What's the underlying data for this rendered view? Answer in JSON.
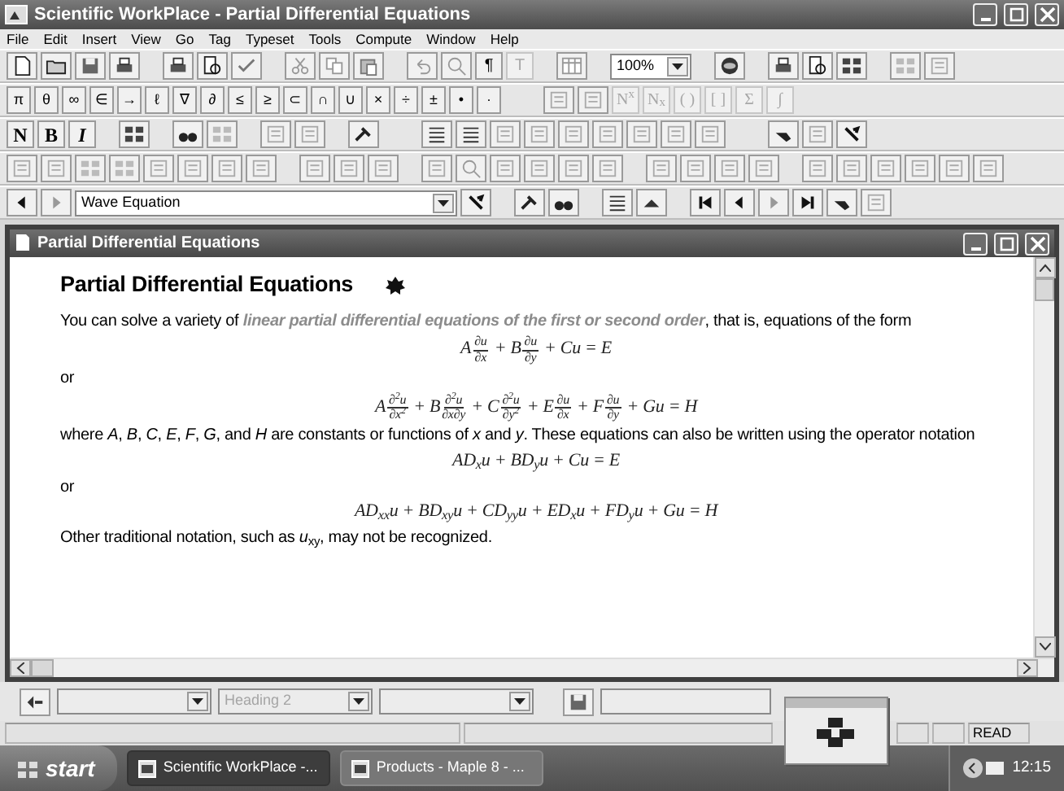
{
  "window": {
    "title": "Scientific WorkPlace - Partial Differential Equations"
  },
  "menu": [
    "File",
    "Edit",
    "Insert",
    "View",
    "Go",
    "Tag",
    "Typeset",
    "Tools",
    "Compute",
    "Window",
    "Help"
  ],
  "standard_toolbar": {
    "text_buttons": [
      {
        "label": "¶",
        "disabled": false
      },
      {
        "label": "T",
        "disabled": true
      }
    ],
    "zoom_box": {
      "value": "100%"
    }
  },
  "symbol_toolbar": {
    "symbols": [
      {
        "label": "π",
        "disabled": false
      },
      {
        "label": "θ",
        "disabled": false
      },
      {
        "label": "∞",
        "disabled": false
      },
      {
        "label": "∈",
        "disabled": false
      },
      {
        "label": "→",
        "disabled": false
      },
      {
        "label": "ℓ",
        "disabled": false
      },
      {
        "label": "∇",
        "disabled": false
      },
      {
        "label": "∂",
        "disabled": false
      },
      {
        "label": "≤",
        "disabled": false
      },
      {
        "label": "≥",
        "disabled": false
      },
      {
        "label": "⊂",
        "disabled": false
      },
      {
        "label": "∩",
        "disabled": false
      },
      {
        "label": "∪",
        "disabled": false
      },
      {
        "label": "×",
        "disabled": false
      },
      {
        "label": "÷",
        "disabled": false
      },
      {
        "label": "±",
        "disabled": false
      },
      {
        "label": "•",
        "disabled": false
      },
      {
        "label": "·",
        "disabled": false
      }
    ],
    "templates": [
      {
        "label": "N$^{x}$",
        "disabled": true
      },
      {
        "label": "N$_{x}$",
        "disabled": true
      },
      {
        "label": "( )",
        "disabled": true
      },
      {
        "label": "[ ]",
        "disabled": true
      },
      {
        "label": "Σ",
        "disabled": true
      },
      {
        "label": "∫",
        "disabled": true
      }
    ]
  },
  "tag_toolbar": {
    "tags": [
      {
        "label": "N",
        "disabled": false
      },
      {
        "label": "B",
        "disabled": false
      },
      {
        "label": "I",
        "disabled": false
      }
    ]
  },
  "navigation_toolbar": {
    "fragment_box": {
      "value": "Wave Equation"
    }
  },
  "document": {
    "title": "Partial Differential Equations",
    "heading": "Partial Differential Equations",
    "blocks": [
      {
        "kind": "para",
        "text": "You can solve a variety of **linear partial differential equations of the first or second order**, that is, equations of the form"
      },
      {
        "kind": "math",
        "parts": [
          {
            "kind": "text",
            "text": "A"
          },
          {
            "kind": "frac",
            "num": "∂u",
            "den": "∂x"
          },
          {
            "kind": "text",
            "text": " + B"
          },
          {
            "kind": "frac",
            "num": "∂u",
            "den": "∂y"
          },
          {
            "kind": "text",
            "text": " + Cu = E"
          }
        ]
      },
      {
        "kind": "para",
        "text": "or"
      },
      {
        "kind": "math",
        "parts": [
          {
            "kind": "text",
            "text": "A"
          },
          {
            "kind": "frac",
            "num": "∂$^{2}$u",
            "den": "∂x$^{2}$"
          },
          {
            "kind": "text",
            "text": " + B"
          },
          {
            "kind": "frac",
            "num": "∂$^{2}$u",
            "den": "∂x∂y"
          },
          {
            "kind": "text",
            "text": " + C"
          },
          {
            "kind": "frac",
            "num": "∂$^{2}$u",
            "den": "∂y$^{2}$"
          },
          {
            "kind": "text",
            "text": " + E"
          },
          {
            "kind": "frac",
            "num": "∂u",
            "den": "∂x"
          },
          {
            "kind": "text",
            "text": " + F"
          },
          {
            "kind": "frac",
            "num": "∂u",
            "den": "∂y"
          },
          {
            "kind": "text",
            "text": " + Gu = H"
          }
        ]
      },
      {
        "kind": "para",
        "text": "where *A*, *B*, *C*, *E*, *F*, *G*, and *H* are constants or functions of *x* and *y*. These equations can also be written using the operator notation"
      },
      {
        "kind": "math",
        "parts": [
          {
            "kind": "text",
            "text": "AD$_{x}$u + BD$_{y}$u + Cu = E"
          }
        ]
      },
      {
        "kind": "para",
        "text": "or"
      },
      {
        "kind": "math",
        "parts": [
          {
            "kind": "text",
            "text": "AD$_{xx}$u + BD$_{xy}$u + CD$_{yy}$u + ED$_{x}$u + FD$_{y}$u + Gu = H"
          }
        ]
      },
      {
        "kind": "para",
        "text": "Other traditional notation, such as *u*$_{xy}$, may not be recognized."
      }
    ]
  },
  "format_bar": {
    "tag_box": {
      "value": "Heading 2",
      "disabled": true
    }
  },
  "status_bar": {
    "mode": "READ"
  },
  "taskbar": {
    "start": "start",
    "tasks": [
      {
        "label": "Scientific WorkPlace -...",
        "selected": true
      },
      {
        "label": "Products - Maple 8 - ...",
        "selected": false
      }
    ],
    "clock": "12:15"
  }
}
